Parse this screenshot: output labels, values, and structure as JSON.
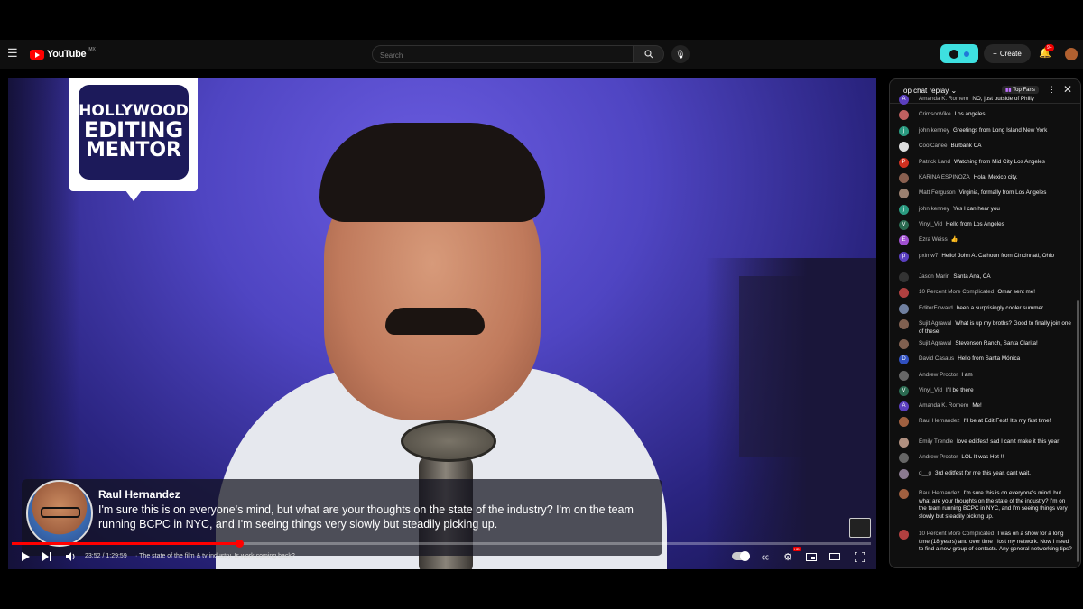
{
  "header": {
    "logo_text": "YouTube",
    "region": "MX",
    "search_placeholder": "Search",
    "create_label": "Create",
    "notif_count": "9+"
  },
  "brand": {
    "lines": [
      "HOLLYWOOD",
      "EDITING",
      "MENTOR"
    ]
  },
  "subtitle": {
    "name": "Raul Hernandez",
    "text": "I'm sure this is on everyone's mind, but what are your thoughts on the state of the industry? I'm on the team running BCPC in NYC, and I'm seeing things very slowly but steadily picking up."
  },
  "player": {
    "time": "23:52 / 1:29:59",
    "chapter": "· The state of the film & tv industry. Is work coming back?",
    "progress_fraction": 0.265
  },
  "chat": {
    "title": "Top chat replay",
    "top_fans_label": "Top Fans",
    "messages": [
      {
        "author": "Amanda K. Romero",
        "text": "NO, just outside of Philly",
        "avatar": "A",
        "color": "#5b3fbf"
      },
      {
        "author": "CrimsonVike",
        "text": "Los angeles",
        "avatar": "",
        "color": "#c06060"
      },
      {
        "author": "john kenney",
        "text": "Greetings from Long Island New York",
        "avatar": "j",
        "color": "#2a9a80"
      },
      {
        "author": "CoolCarlee",
        "text": "Burbank CA",
        "avatar": "",
        "color": "#ddd"
      },
      {
        "author": "Patrick Land",
        "text": "Watching from Mid City Los Angeles",
        "avatar": "P",
        "color": "#d03020"
      },
      {
        "author": "KARINA ESPINOZA",
        "text": "Hola, Mexico city.",
        "avatar": "",
        "color": "#8a6050"
      },
      {
        "author": "Matt Ferguson",
        "text": "Virginia, formally from Los Angeles",
        "avatar": "",
        "color": "#9a8070"
      },
      {
        "author": "john kenney",
        "text": "Yes I can hear you",
        "avatar": "j",
        "color": "#2a9a80"
      },
      {
        "author": "Vinyl_Vid",
        "text": "Hello from Los Angeles",
        "avatar": "V",
        "color": "#2a6a50"
      },
      {
        "author": "Ezra Weiss",
        "text": "👍",
        "avatar": "E",
        "color": "#a050d0"
      },
      {
        "author": "pxlmw7",
        "text": "Hello! John A. Calhoun from Cincinnati, Ohio",
        "avatar": "p",
        "color": "#5a3fbf"
      },
      {
        "author": "Jason Marin",
        "text": "Santa Ana, CA",
        "avatar": "",
        "color": "#333"
      },
      {
        "author": "10 Percent More Complicated",
        "text": "Omar sent me!",
        "avatar": "",
        "color": "#b04040"
      },
      {
        "author": "EditorEdward",
        "text": "been a surprisingly cooler summer",
        "avatar": "",
        "color": "#7080a0"
      },
      {
        "author": "Sujit Agrawal",
        "text": "What is up my broths? Good to finally join one of these!",
        "avatar": "",
        "color": "#806050"
      },
      {
        "author": "Sujit Agrawal",
        "text": "Stevenson Ranch, Santa Clarita!",
        "avatar": "",
        "color": "#806050"
      },
      {
        "author": "David Casaus",
        "text": "Hello from Santa Mónica",
        "avatar": "D",
        "color": "#3050c0"
      },
      {
        "author": "Andrew Proctor",
        "text": "I am",
        "avatar": "",
        "color": "#666"
      },
      {
        "author": "Vinyl_Vid",
        "text": "I'll be there",
        "avatar": "V",
        "color": "#2a6a50"
      },
      {
        "author": "Amanda K. Romero",
        "text": "Me!",
        "avatar": "A",
        "color": "#5b3fbf"
      },
      {
        "author": "Raul Hernandez",
        "text": "I'll be at Edit Fest! It's my first time!",
        "avatar": "",
        "color": "#a06040"
      },
      {
        "author": "Emily Trendle",
        "text": "love editfest! sad I can't make it this year",
        "avatar": "",
        "color": "#b09080"
      },
      {
        "author": "Andrew Proctor",
        "text": "LOL It was Hot !!",
        "avatar": "",
        "color": "#666"
      },
      {
        "author": "d__g",
        "text": "3rd editfest for me this year. cant wait.",
        "avatar": "",
        "color": "#8a7a90"
      },
      {
        "author": "Raul Hernandez",
        "text": "I'm sure this is on everyone's mind, but what are your thoughts on the state of the industry? I'm on the team running BCPC in NYC, and I'm seeing things very slowly but steadily picking up.",
        "avatar": "",
        "color": "#a06040"
      },
      {
        "author": "10 Percent More Complicated",
        "text": "I was on a show for a long time (18 years) and over time I lost my network. Now I need to find a new group of contacts. Any general networking tips?",
        "avatar": "",
        "color": "#b04040"
      }
    ]
  }
}
